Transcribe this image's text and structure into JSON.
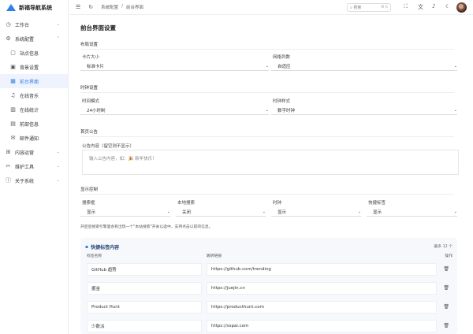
{
  "app": {
    "title": "新福导航系统"
  },
  "sidebar": {
    "items": [
      {
        "label": "工作台",
        "icon": "clock-icon"
      },
      {
        "label": "系统配置",
        "icon": "gear-icon"
      },
      {
        "label": "站点信息",
        "icon": "doc-icon"
      },
      {
        "label": "背景设置",
        "icon": "image-icon"
      },
      {
        "label": "前台界面",
        "icon": "grid-icon"
      },
      {
        "label": "在线音乐",
        "icon": "music-icon"
      },
      {
        "label": "在线统计",
        "icon": "chart-icon"
      },
      {
        "label": "前部信息",
        "icon": "info-icon"
      },
      {
        "label": "邮件通知",
        "icon": "mail-icon"
      },
      {
        "label": "内容运营",
        "icon": "grid-icon"
      },
      {
        "label": "维护工具",
        "icon": "wrench-icon"
      },
      {
        "label": "关于系统",
        "icon": "info-icon"
      }
    ]
  },
  "header": {
    "breadcrumb": [
      "系统配置",
      "/",
      "前台界面"
    ],
    "search_placeholder": "搜索",
    "search_shortcut": "⌘ K"
  },
  "page": {
    "title": "前台界面设置"
  },
  "layout_section": {
    "title": "布局设置",
    "card_size_label": "卡片大小",
    "card_size_value": "标准卡片",
    "columns_label": "网格列数",
    "columns_value": "自适应"
  },
  "clock_section": {
    "title": "时钟设置",
    "time_mode_label": "时间模式",
    "time_mode_value": "24小时制",
    "clock_style_label": "时钟样式",
    "clock_style_value": "数字时钟"
  },
  "announce_section": {
    "title": "首页公告",
    "content_label": "公告内容（留空则不显示）",
    "content_placeholder": "输入公告内容，如：🎉 新年快乐！"
  },
  "display_section": {
    "title": "显示控制",
    "fields": [
      {
        "label": "搜索框",
        "value": "显示"
      },
      {
        "label": "本地搜索",
        "value": "关闭"
      },
      {
        "label": "时钟",
        "value": "显示"
      },
      {
        "label": "快捷标签",
        "value": "显示"
      }
    ],
    "hint": "开启后搜索引擎里会有出现一个\"本站搜索\"开关以选中，支持点击以前的信息。"
  },
  "quick_tags": {
    "title": "快捷标签内容",
    "count": "最多 12 个",
    "col_name": "标签名称",
    "col_url": "跳转链接",
    "col_action": "操作",
    "rows": [
      {
        "name": "GitHub 趋势",
        "url": "https://github.com/trending"
      },
      {
        "name": "掘金",
        "url": "https://juejin.cn"
      },
      {
        "name": "Product Hunt",
        "url": "https://producthunt.com"
      },
      {
        "name": "少数派",
        "url": "https://sspai.com"
      }
    ]
  },
  "colors": {
    "accent": "#2f7de1",
    "active_bg": "#eef3fe"
  }
}
